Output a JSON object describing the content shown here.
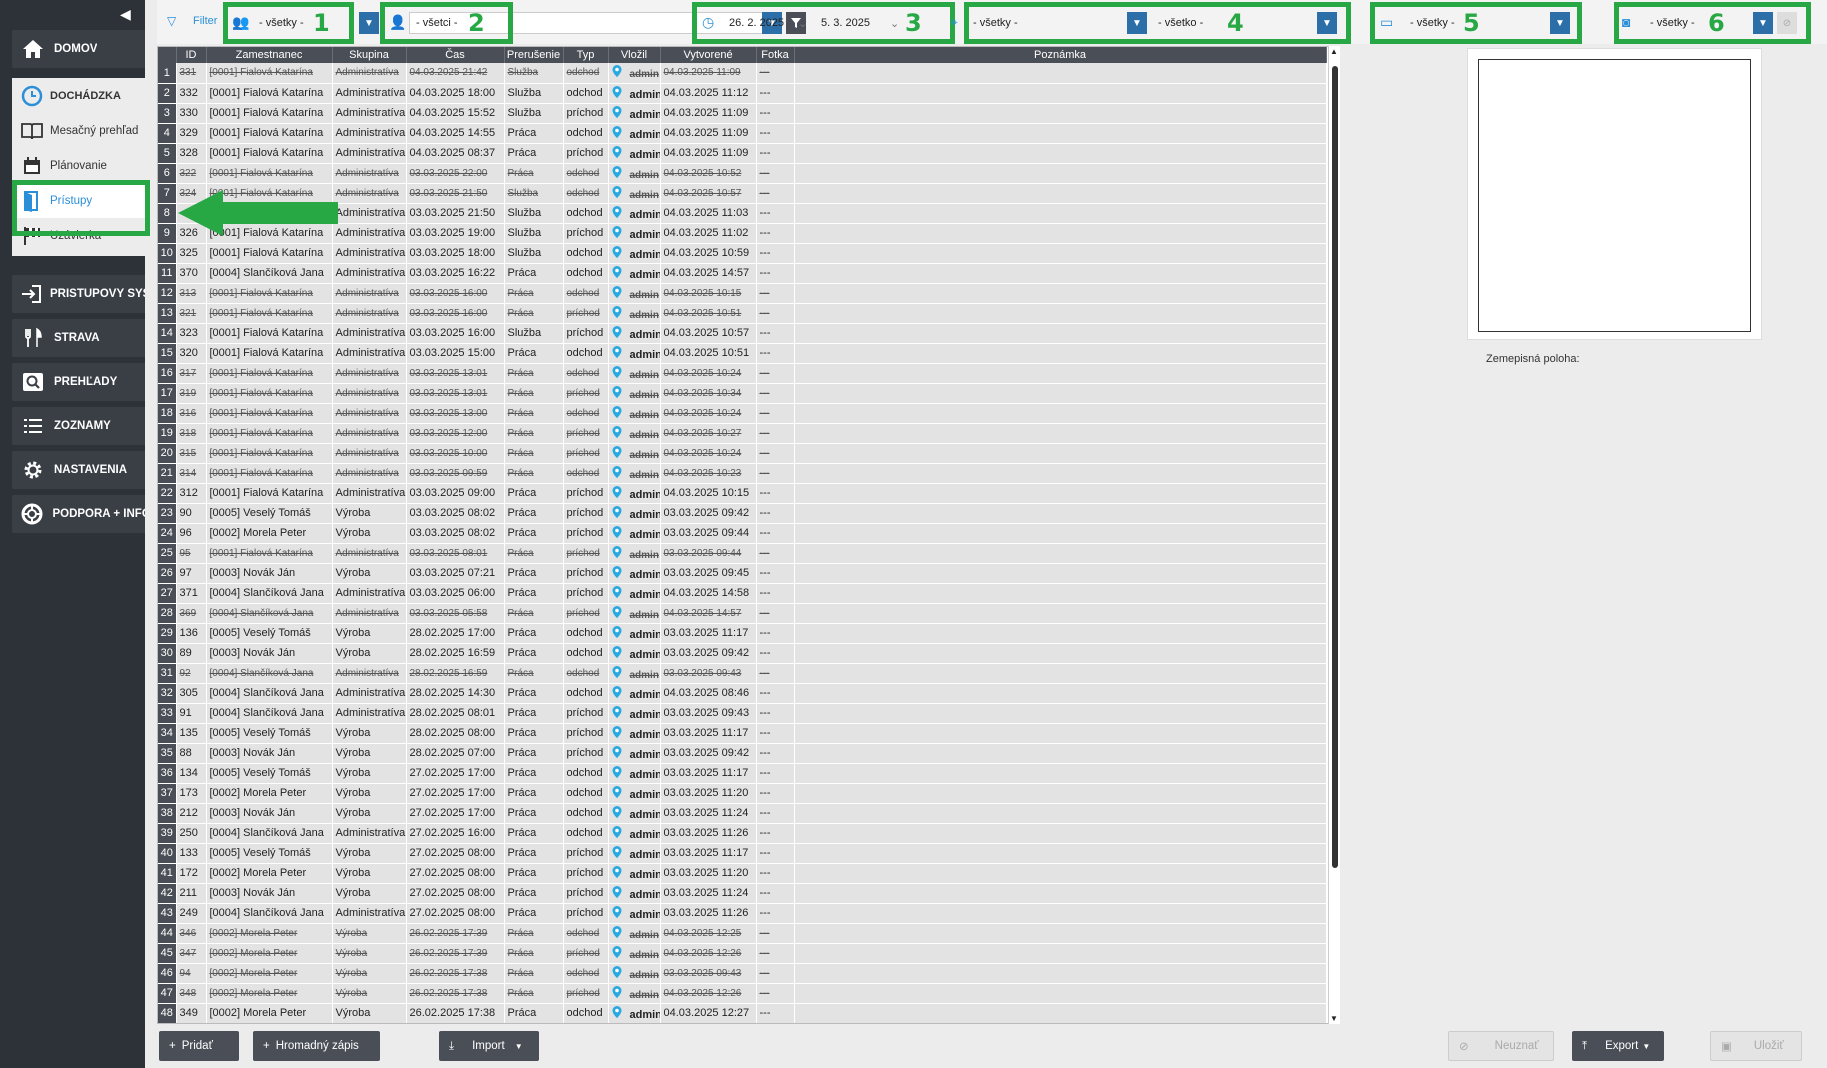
{
  "sidebar": {
    "items": [
      {
        "label": "DOMOV",
        "icon": "home-icon"
      },
      {
        "label": "DOCHÁDZKA",
        "icon": "clock-icon"
      },
      {
        "label": "Mesačný prehľad",
        "icon": "book-icon"
      },
      {
        "label": "Plánovanie",
        "icon": "calendar-icon"
      },
      {
        "label": "Prístupy",
        "icon": "door-icon"
      },
      {
        "label": "Uzávierka",
        "icon": "flag-icon"
      },
      {
        "label": "PRÍSTUPOVÝ SYSTÉM",
        "icon": "login-icon"
      },
      {
        "label": "STRAVA",
        "icon": "cutlery-icon"
      },
      {
        "label": "PREHĽADY",
        "icon": "search-icon"
      },
      {
        "label": "ZOZNAMY",
        "icon": "list-icon"
      },
      {
        "label": "NASTAVENIA",
        "icon": "gear-icon"
      },
      {
        "label": "PODPORA + INFO",
        "icon": "lifebuoy-icon"
      }
    ]
  },
  "toolbar": {
    "filter_label": "Filter",
    "group": "- všetky -",
    "employee": "- všetci -",
    "date_from": "26. 2. 2025",
    "date_to": "5. 3. 2025",
    "location": "- všetky -",
    "interruption": "- všetko -",
    "type": "- všetky -",
    "photo": "- všetky -",
    "callouts": [
      "1",
      "2",
      "3",
      "4",
      "5",
      "6"
    ]
  },
  "table": {
    "columns": [
      "ID",
      "Zamestnanec",
      "Skupina",
      "Čas",
      "Prerušenie",
      "Typ",
      "Vložil",
      "Vytvorené",
      "Fotka",
      "Poznámka"
    ],
    "rows": [
      {
        "n": "1",
        "id": "331",
        "emp": "[0001] Fialová Katarína",
        "grp": "Administratíva",
        "time": "04.03.2025 21:42",
        "intr": "Služba",
        "type": "odchod",
        "by": "admin",
        "created": "04.03.2025 11:09",
        "photo": "---",
        "del": true
      },
      {
        "n": "2",
        "id": "332",
        "emp": "[0001] Fialová Katarína",
        "grp": "Administratíva",
        "time": "04.03.2025 18:00",
        "intr": "Služba",
        "type": "odchod",
        "by": "admin",
        "created": "04.03.2025 11:12",
        "photo": "---",
        "del": false
      },
      {
        "n": "3",
        "id": "330",
        "emp": "[0001] Fialová Katarína",
        "grp": "Administratíva",
        "time": "04.03.2025 15:52",
        "intr": "Služba",
        "type": "príchod",
        "by": "admin",
        "created": "04.03.2025 11:09",
        "photo": "---",
        "del": false
      },
      {
        "n": "4",
        "id": "329",
        "emp": "[0001] Fialová Katarína",
        "grp": "Administratíva",
        "time": "04.03.2025 14:55",
        "intr": "Práca",
        "type": "odchod",
        "by": "admin",
        "created": "04.03.2025 11:09",
        "photo": "---",
        "del": false
      },
      {
        "n": "5",
        "id": "328",
        "emp": "[0001] Fialová Katarína",
        "grp": "Administratíva",
        "time": "04.03.2025 08:37",
        "intr": "Práca",
        "type": "príchod",
        "by": "admin",
        "created": "04.03.2025 11:09",
        "photo": "---",
        "del": false
      },
      {
        "n": "6",
        "id": "322",
        "emp": "[0001] Fialová Katarína",
        "grp": "Administratíva",
        "time": "03.03.2025 22:00",
        "intr": "Práca",
        "type": "odchod",
        "by": "admin",
        "created": "04.03.2025 10:52",
        "photo": "---",
        "del": true
      },
      {
        "n": "7",
        "id": "324",
        "emp": "[0001] Fialová Katarína",
        "grp": "Administratíva",
        "time": "03.03.2025 21:50",
        "intr": "Služba",
        "type": "odchod",
        "by": "admin",
        "created": "04.03.2025 10:57",
        "photo": "---",
        "del": true
      },
      {
        "n": "8",
        "id": "",
        "emp": "",
        "grp": "Administratíva",
        "time": "03.03.2025 21:50",
        "intr": "Služba",
        "type": "odchod",
        "by": "admin",
        "created": "04.03.2025 11:03",
        "photo": "---",
        "del": false
      },
      {
        "n": "9",
        "id": "326",
        "emp": "[0001] Fialová Katarína",
        "grp": "Administratíva",
        "time": "03.03.2025 19:00",
        "intr": "Služba",
        "type": "príchod",
        "by": "admin",
        "created": "04.03.2025 11:02",
        "photo": "---",
        "del": false
      },
      {
        "n": "10",
        "id": "325",
        "emp": "[0001] Fialová Katarína",
        "grp": "Administratíva",
        "time": "03.03.2025 18:00",
        "intr": "Služba",
        "type": "odchod",
        "by": "admin",
        "created": "04.03.2025 10:59",
        "photo": "---",
        "del": false
      },
      {
        "n": "11",
        "id": "370",
        "emp": "[0004] Slančíková Jana",
        "grp": "Administratíva",
        "time": "03.03.2025 16:22",
        "intr": "Práca",
        "type": "odchod",
        "by": "admin",
        "created": "04.03.2025 14:57",
        "photo": "---",
        "del": false
      },
      {
        "n": "12",
        "id": "313",
        "emp": "[0001] Fialová Katarína",
        "grp": "Administratíva",
        "time": "03.03.2025 16:00",
        "intr": "Práca",
        "type": "odchod",
        "by": "admin",
        "created": "04.03.2025 10:15",
        "photo": "---",
        "del": true
      },
      {
        "n": "13",
        "id": "321",
        "emp": "[0001] Fialová Katarína",
        "grp": "Administratíva",
        "time": "03.03.2025 16:00",
        "intr": "Práca",
        "type": "príchod",
        "by": "admin",
        "created": "04.03.2025 10:51",
        "photo": "---",
        "del": true
      },
      {
        "n": "14",
        "id": "323",
        "emp": "[0001] Fialová Katarína",
        "grp": "Administratíva",
        "time": "03.03.2025 16:00",
        "intr": "Služba",
        "type": "príchod",
        "by": "admin",
        "created": "04.03.2025 10:57",
        "photo": "---",
        "del": false
      },
      {
        "n": "15",
        "id": "320",
        "emp": "[0001] Fialová Katarína",
        "grp": "Administratíva",
        "time": "03.03.2025 15:00",
        "intr": "Práca",
        "type": "odchod",
        "by": "admin",
        "created": "04.03.2025 10:51",
        "photo": "---",
        "del": false
      },
      {
        "n": "16",
        "id": "317",
        "emp": "[0001] Fialová Katarína",
        "grp": "Administratíva",
        "time": "03.03.2025 13:01",
        "intr": "Práca",
        "type": "odchod",
        "by": "admin",
        "created": "04.03.2025 10:24",
        "photo": "---",
        "del": true
      },
      {
        "n": "17",
        "id": "319",
        "emp": "[0001] Fialová Katarína",
        "grp": "Administratíva",
        "time": "03.03.2025 13:01",
        "intr": "Práca",
        "type": "príchod",
        "by": "admin",
        "created": "04.03.2025 10:34",
        "photo": "---",
        "del": true
      },
      {
        "n": "18",
        "id": "316",
        "emp": "[0001] Fialová Katarína",
        "grp": "Administratíva",
        "time": "03.03.2025 13:00",
        "intr": "Práca",
        "type": "odchod",
        "by": "admin",
        "created": "04.03.2025 10:24",
        "photo": "---",
        "del": true
      },
      {
        "n": "19",
        "id": "318",
        "emp": "[0001] Fialová Katarína",
        "grp": "Administratíva",
        "time": "03.03.2025 12:00",
        "intr": "Práca",
        "type": "príchod",
        "by": "admin",
        "created": "04.03.2025 10:27",
        "photo": "---",
        "del": true
      },
      {
        "n": "20",
        "id": "315",
        "emp": "[0001] Fialová Katarína",
        "grp": "Administratíva",
        "time": "03.03.2025 10:00",
        "intr": "Práca",
        "type": "príchod",
        "by": "admin",
        "created": "04.03.2025 10:24",
        "photo": "---",
        "del": true
      },
      {
        "n": "21",
        "id": "314",
        "emp": "[0001] Fialová Katarína",
        "grp": "Administratíva",
        "time": "03.03.2025 09:59",
        "intr": "Práca",
        "type": "odchod",
        "by": "admin",
        "created": "04.03.2025 10:23",
        "photo": "---",
        "del": true
      },
      {
        "n": "22",
        "id": "312",
        "emp": "[0001] Fialová Katarína",
        "grp": "Administratíva",
        "time": "03.03.2025 09:00",
        "intr": "Práca",
        "type": "príchod",
        "by": "admin",
        "created": "04.03.2025 10:15",
        "photo": "---",
        "del": false
      },
      {
        "n": "23",
        "id": "90",
        "emp": "[0005] Veselý Tomáš",
        "grp": "Výroba",
        "time": "03.03.2025 08:02",
        "intr": "Práca",
        "type": "príchod",
        "by": "admin",
        "created": "03.03.2025 09:42",
        "photo": "---",
        "del": false
      },
      {
        "n": "24",
        "id": "96",
        "emp": "[0002] Morela Peter",
        "grp": "Výroba",
        "time": "03.03.2025 08:02",
        "intr": "Práca",
        "type": "príchod",
        "by": "admin",
        "created": "03.03.2025 09:44",
        "photo": "---",
        "del": false
      },
      {
        "n": "25",
        "id": "95",
        "emp": "[0001] Fialová Katarína",
        "grp": "Administratíva",
        "time": "03.03.2025 08:01",
        "intr": "Práca",
        "type": "príchod",
        "by": "admin",
        "created": "03.03.2025 09:44",
        "photo": "---",
        "del": true
      },
      {
        "n": "26",
        "id": "97",
        "emp": "[0003] Novák Ján",
        "grp": "Výroba",
        "time": "03.03.2025 07:21",
        "intr": "Práca",
        "type": "príchod",
        "by": "admin",
        "created": "03.03.2025 09:45",
        "photo": "---",
        "del": false
      },
      {
        "n": "27",
        "id": "371",
        "emp": "[0004] Slančíková Jana",
        "grp": "Administratíva",
        "time": "03.03.2025 06:00",
        "intr": "Práca",
        "type": "príchod",
        "by": "admin",
        "created": "04.03.2025 14:58",
        "photo": "---",
        "del": false
      },
      {
        "n": "28",
        "id": "369",
        "emp": "[0004] Slančíková Jana",
        "grp": "Administratíva",
        "time": "03.03.2025 05:58",
        "intr": "Práca",
        "type": "príchod",
        "by": "admin",
        "created": "04.03.2025 14:57",
        "photo": "---",
        "del": true
      },
      {
        "n": "29",
        "id": "136",
        "emp": "[0005] Veselý Tomáš",
        "grp": "Výroba",
        "time": "28.02.2025 17:00",
        "intr": "Práca",
        "type": "odchod",
        "by": "admin",
        "created": "03.03.2025 11:17",
        "photo": "---",
        "del": false
      },
      {
        "n": "30",
        "id": "89",
        "emp": "[0003] Novák Ján",
        "grp": "Výroba",
        "time": "28.02.2025 16:59",
        "intr": "Práca",
        "type": "odchod",
        "by": "admin",
        "created": "03.03.2025 09:42",
        "photo": "---",
        "del": false
      },
      {
        "n": "31",
        "id": "92",
        "emp": "[0004] Slančíková Jana",
        "grp": "Administratíva",
        "time": "28.02.2025 16:59",
        "intr": "Práca",
        "type": "odchod",
        "by": "admin",
        "created": "03.03.2025 09:43",
        "photo": "---",
        "del": true
      },
      {
        "n": "32",
        "id": "305",
        "emp": "[0004] Slančíková Jana",
        "grp": "Administratíva",
        "time": "28.02.2025 14:30",
        "intr": "Práca",
        "type": "odchod",
        "by": "admin",
        "created": "04.03.2025 08:46",
        "photo": "---",
        "del": false
      },
      {
        "n": "33",
        "id": "91",
        "emp": "[0004] Slančíková Jana",
        "grp": "Administratíva",
        "time": "28.02.2025 08:01",
        "intr": "Práca",
        "type": "príchod",
        "by": "admin",
        "created": "03.03.2025 09:43",
        "photo": "---",
        "del": false
      },
      {
        "n": "34",
        "id": "135",
        "emp": "[0005] Veselý Tomáš",
        "grp": "Výroba",
        "time": "28.02.2025 08:00",
        "intr": "Práca",
        "type": "príchod",
        "by": "admin",
        "created": "03.03.2025 11:17",
        "photo": "---",
        "del": false
      },
      {
        "n": "35",
        "id": "88",
        "emp": "[0003] Novák Ján",
        "grp": "Výroba",
        "time": "28.02.2025 07:00",
        "intr": "Práca",
        "type": "príchod",
        "by": "admin",
        "created": "03.03.2025 09:42",
        "photo": "---",
        "del": false
      },
      {
        "n": "36",
        "id": "134",
        "emp": "[0005] Veselý Tomáš",
        "grp": "Výroba",
        "time": "27.02.2025 17:00",
        "intr": "Práca",
        "type": "odchod",
        "by": "admin",
        "created": "03.03.2025 11:17",
        "photo": "---",
        "del": false
      },
      {
        "n": "37",
        "id": "173",
        "emp": "[0002] Morela Peter",
        "grp": "Výroba",
        "time": "27.02.2025 17:00",
        "intr": "Práca",
        "type": "odchod",
        "by": "admin",
        "created": "03.03.2025 11:20",
        "photo": "---",
        "del": false
      },
      {
        "n": "38",
        "id": "212",
        "emp": "[0003] Novák Ján",
        "grp": "Výroba",
        "time": "27.02.2025 17:00",
        "intr": "Práca",
        "type": "odchod",
        "by": "admin",
        "created": "03.03.2025 11:24",
        "photo": "---",
        "del": false
      },
      {
        "n": "39",
        "id": "250",
        "emp": "[0004] Slančíková Jana",
        "grp": "Administratíva",
        "time": "27.02.2025 16:00",
        "intr": "Práca",
        "type": "odchod",
        "by": "admin",
        "created": "03.03.2025 11:26",
        "photo": "---",
        "del": false
      },
      {
        "n": "40",
        "id": "133",
        "emp": "[0005] Veselý Tomáš",
        "grp": "Výroba",
        "time": "27.02.2025 08:00",
        "intr": "Práca",
        "type": "príchod",
        "by": "admin",
        "created": "03.03.2025 11:17",
        "photo": "---",
        "del": false
      },
      {
        "n": "41",
        "id": "172",
        "emp": "[0002] Morela Peter",
        "grp": "Výroba",
        "time": "27.02.2025 08:00",
        "intr": "Práca",
        "type": "príchod",
        "by": "admin",
        "created": "03.03.2025 11:20",
        "photo": "---",
        "del": false
      },
      {
        "n": "42",
        "id": "211",
        "emp": "[0003] Novák Ján",
        "grp": "Výroba",
        "time": "27.02.2025 08:00",
        "intr": "Práca",
        "type": "príchod",
        "by": "admin",
        "created": "03.03.2025 11:24",
        "photo": "---",
        "del": false
      },
      {
        "n": "43",
        "id": "249",
        "emp": "[0004] Slančíková Jana",
        "grp": "Administratíva",
        "time": "27.02.2025 08:00",
        "intr": "Práca",
        "type": "príchod",
        "by": "admin",
        "created": "03.03.2025 11:26",
        "photo": "---",
        "del": false
      },
      {
        "n": "44",
        "id": "346",
        "emp": "[0002] Morela Peter",
        "grp": "Výroba",
        "time": "26.02.2025 17:39",
        "intr": "Práca",
        "type": "odchod",
        "by": "admin",
        "created": "04.03.2025 12:25",
        "photo": "---",
        "del": true
      },
      {
        "n": "45",
        "id": "347",
        "emp": "[0002] Morela Peter",
        "grp": "Výroba",
        "time": "26.02.2025 17:39",
        "intr": "Práca",
        "type": "príchod",
        "by": "admin",
        "created": "04.03.2025 12:26",
        "photo": "---",
        "del": true
      },
      {
        "n": "46",
        "id": "94",
        "emp": "[0002] Morela Peter",
        "grp": "Výroba",
        "time": "26.02.2025 17:38",
        "intr": "Práca",
        "type": "odchod",
        "by": "admin",
        "created": "03.03.2025 09:43",
        "photo": "---",
        "del": true
      },
      {
        "n": "47",
        "id": "348",
        "emp": "[0002] Morela Peter",
        "grp": "Výroba",
        "time": "26.02.2025 17:38",
        "intr": "Práca",
        "type": "príchod",
        "by": "admin",
        "created": "04.03.2025 12:26",
        "photo": "---",
        "del": true
      },
      {
        "n": "48",
        "id": "349",
        "emp": "[0002] Morela Peter",
        "grp": "Výroba",
        "time": "26.02.2025 17:38",
        "intr": "Práca",
        "type": "odchod",
        "by": "admin",
        "created": "04.03.2025 12:27",
        "photo": "---",
        "del": false
      }
    ]
  },
  "right_panel": {
    "geo_label": "Zemepisná poloha:"
  },
  "bottom": {
    "add": "Pridať",
    "bulk": "Hromadný zápis",
    "import": "Import",
    "reject": "Neuznať",
    "export": "Export",
    "save": "Uložiť"
  },
  "colors": {
    "accent": "#2c6fa8",
    "callout": "#27a845",
    "sidebar": "#2d3239",
    "header": "#4a4f57"
  }
}
